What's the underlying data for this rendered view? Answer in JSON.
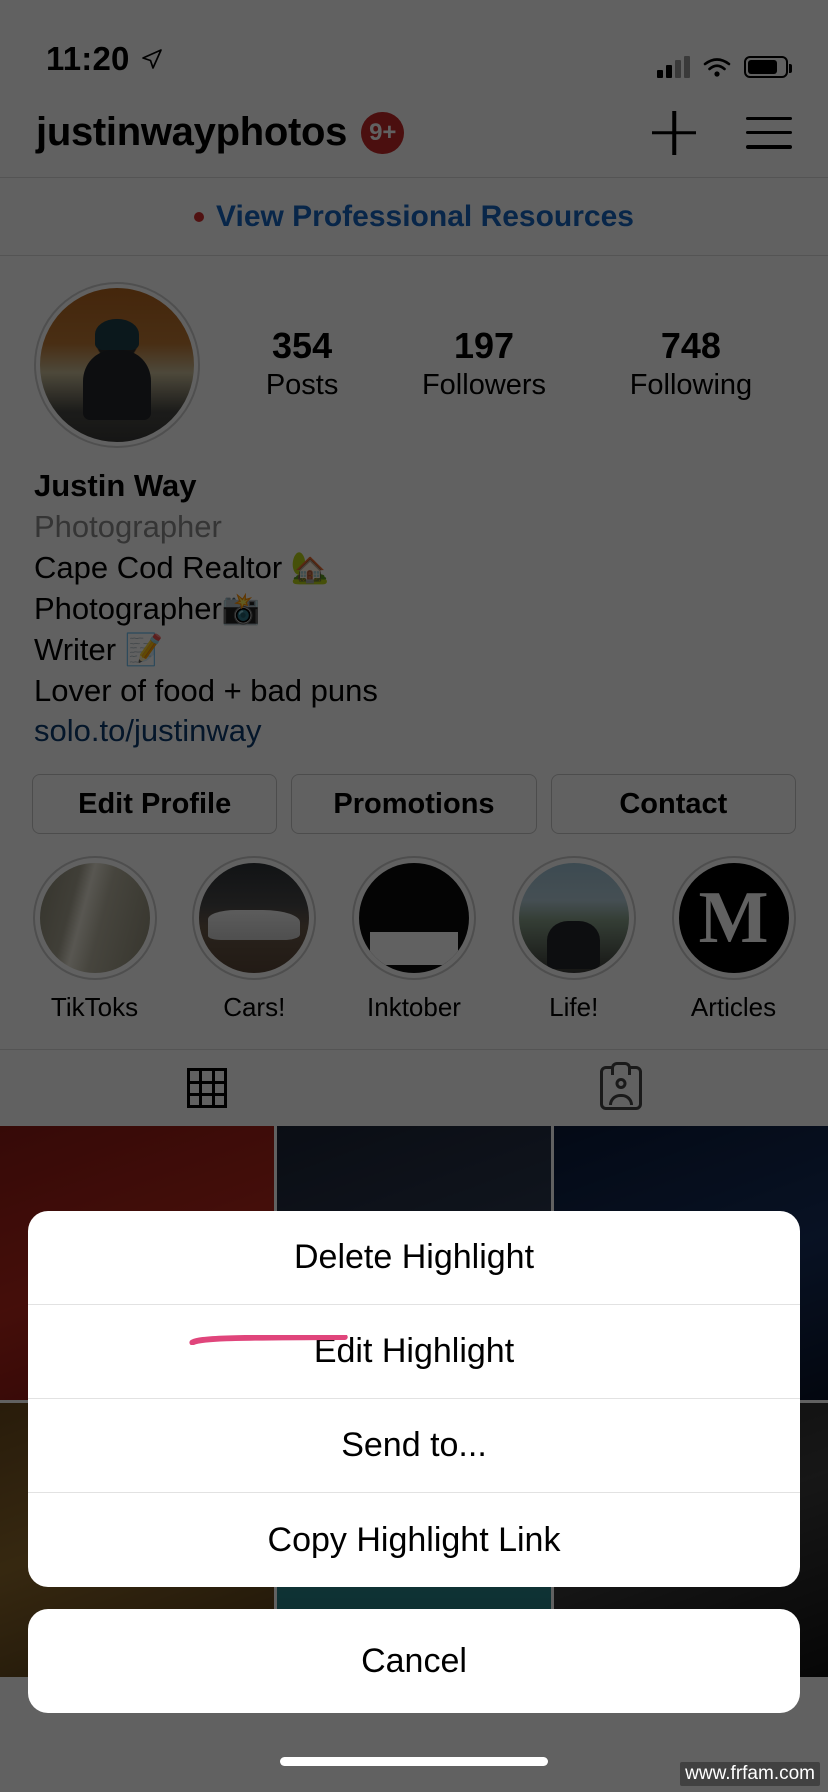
{
  "status_bar": {
    "time": "11:20",
    "location_icon": "location-arrow-icon",
    "signal_icon": "cellular-signal-icon",
    "wifi_icon": "wifi-icon",
    "battery_icon": "battery-icon"
  },
  "nav": {
    "username": "justinwayphotos",
    "badge": "9+",
    "add_icon": "plus-icon",
    "menu_icon": "hamburger-menu-icon"
  },
  "professional": {
    "link_label": "View Professional Resources",
    "dot_color": "#d32f2f",
    "link_color": "#1565c0"
  },
  "profile": {
    "avatar_alt": "profile-photo",
    "stats": [
      {
        "value": "354",
        "label": "Posts"
      },
      {
        "value": "197",
        "label": "Followers"
      },
      {
        "value": "748",
        "label": "Following"
      }
    ],
    "display_name": "Justin Way",
    "category": "Photographer",
    "bio_lines": [
      "Cape Cod Realtor 🏡",
      "Photographer📸",
      "Writer 📝",
      "Lover of food + bad puns"
    ],
    "website": "solo.to/justinway"
  },
  "action_buttons": [
    {
      "label": "Edit Profile"
    },
    {
      "label": "Promotions"
    },
    {
      "label": "Contact"
    }
  ],
  "highlights": [
    {
      "label": "TikToks",
      "art": "hl-tiktok"
    },
    {
      "label": "Cars!",
      "art": "hl-cars"
    },
    {
      "label": "Inktober",
      "art": "hl-ink"
    },
    {
      "label": "Life!",
      "art": "hl-life"
    },
    {
      "label": "Articles",
      "art": "hl-art"
    }
  ],
  "tabs": [
    {
      "icon": "grid-icon",
      "selected": true
    },
    {
      "icon": "tagged-person-icon",
      "selected": false
    }
  ],
  "action_sheet": {
    "items": [
      {
        "label": "Delete Highlight"
      },
      {
        "label": "Edit Highlight",
        "annotated": true
      },
      {
        "label": "Send to..."
      },
      {
        "label": "Copy Highlight Link"
      }
    ],
    "cancel_label": "Cancel",
    "annotation_color": "#e0457b"
  },
  "watermark": {
    "text": "www.frfam.com"
  }
}
